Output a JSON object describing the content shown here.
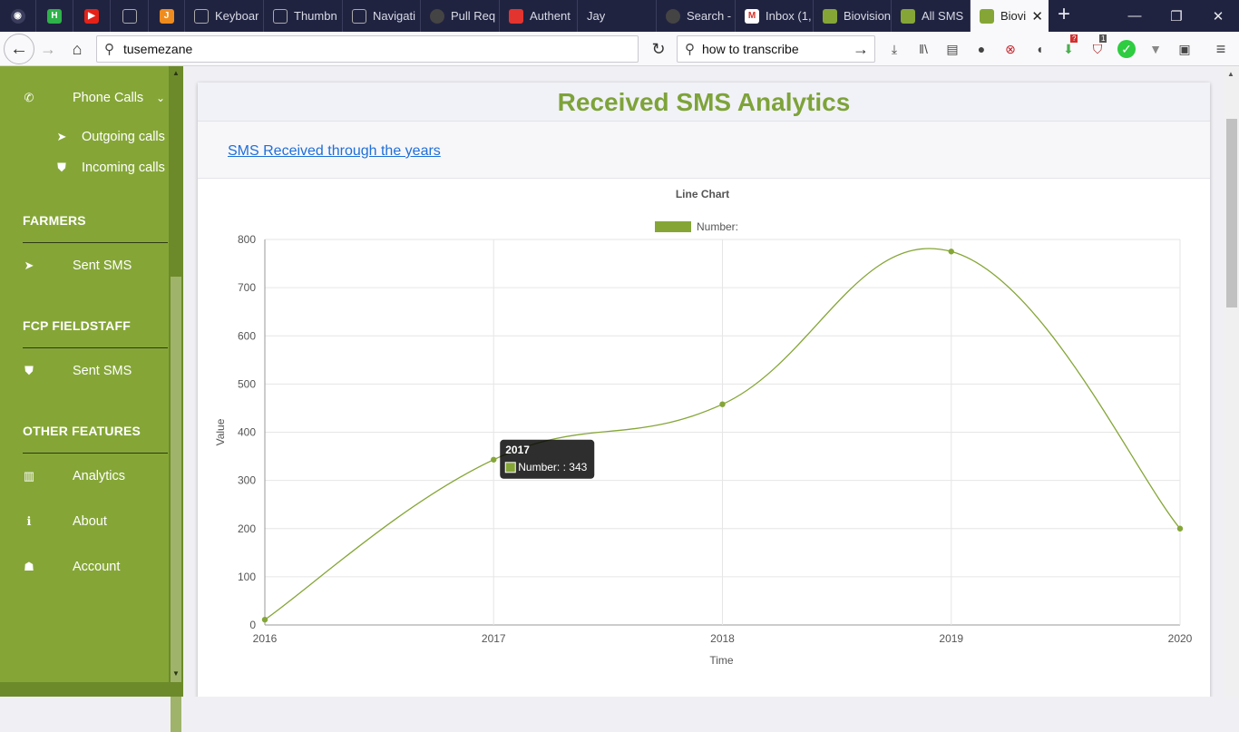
{
  "browser": {
    "pinned_tabs": [
      {
        "icon": "camera-icon",
        "color": "#3a3d5c"
      },
      {
        "icon": "h-shield-icon",
        "color": "#2fb24a",
        "letter": "H"
      },
      {
        "icon": "youtube-icon",
        "color": "#e62117"
      },
      {
        "icon": "monitor-icon",
        "color": "#3a3d5c"
      },
      {
        "icon": "j-icon",
        "color": "#f08c1e",
        "letter": "J"
      }
    ],
    "tabs": [
      {
        "title": "Keyboar",
        "icon": "monitor-icon",
        "color": "#555a78"
      },
      {
        "title": "Thumbn",
        "icon": "monitor-icon",
        "color": "#555a78"
      },
      {
        "title": "Navigati",
        "icon": "monitor-icon",
        "color": "#555a78"
      },
      {
        "title": "Pull Req",
        "icon": "github-icon",
        "color": "#333"
      },
      {
        "title": "Authent",
        "icon": "laravel-icon",
        "color": "#e3342f"
      },
      {
        "title": "Jay",
        "icon": "",
        "color": ""
      },
      {
        "title": "Search -",
        "icon": "github-icon",
        "color": "#333"
      },
      {
        "title": "Inbox (1,",
        "icon": "gmail-icon",
        "color": "#d93025"
      },
      {
        "title": "Biovision",
        "icon": "biovision-icon",
        "color": "#85a637"
      },
      {
        "title": "All SMS",
        "icon": "biovision-icon",
        "color": "#85a637"
      },
      {
        "title": "Biovi",
        "icon": "biovision-icon",
        "color": "#85a637",
        "active": true
      }
    ],
    "url": "tusemezane",
    "search": "how to transcribe",
    "badges": {
      "downloads": "?",
      "ublock": "1"
    }
  },
  "sidebar": {
    "phone_calls": "Phone Calls",
    "outgoing_calls": "Outgoing calls",
    "incoming_calls": "Incoming calls",
    "farmers_heading": "FARMERS",
    "farmers_sent_sms": "Sent SMS",
    "fcp_heading": "FCP FIELDSTAFF",
    "fcp_sent_sms": "Sent SMS",
    "other_heading": "OTHER FEATURES",
    "analytics": "Analytics",
    "about": "About",
    "account": "Account"
  },
  "main": {
    "title": "Received SMS Analytics",
    "sub_link": "SMS Received through the years"
  },
  "chart_data": {
    "type": "line",
    "title": "Line Chart",
    "categories": [
      "2016",
      "2017",
      "2018",
      "2019",
      "2020"
    ],
    "series": [
      {
        "name": "Number:",
        "values": [
          11,
          343,
          458,
          775,
          200
        ],
        "color": "#85a637"
      }
    ],
    "xlabel": "Time",
    "ylabel": "Value",
    "ylim": [
      0,
      800
    ],
    "yticks": [
      0,
      100,
      200,
      300,
      400,
      500,
      600,
      700,
      800
    ],
    "grid": true,
    "legend": "top",
    "tooltip": {
      "title": "2017",
      "label": "Number: : 343",
      "index": 1
    }
  }
}
